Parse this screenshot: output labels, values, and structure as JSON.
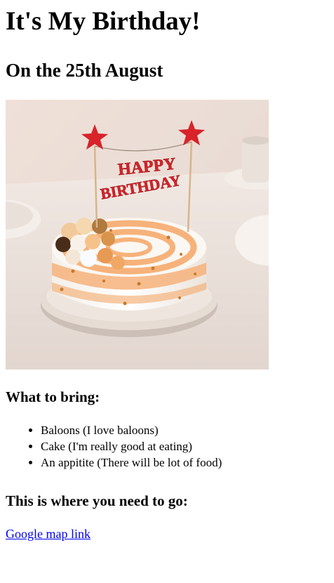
{
  "title": "It's My Birthday!",
  "subtitle": "On the 25th August",
  "image": {
    "topper_text": "HAPPY BIRTHDAY",
    "topper_color": "#d8232a",
    "frosting_color": "#f6b27a"
  },
  "bring": {
    "heading": "What to bring:",
    "items": [
      "Baloons (I love baloons)",
      "Cake (I'm really good at eating)",
      "An appitite (There will be lot of food)"
    ]
  },
  "location": {
    "heading": "This is where you need to go:",
    "link_text": "Google map link"
  },
  "colors": {
    "link": "#0000ee",
    "text": "#000000"
  }
}
